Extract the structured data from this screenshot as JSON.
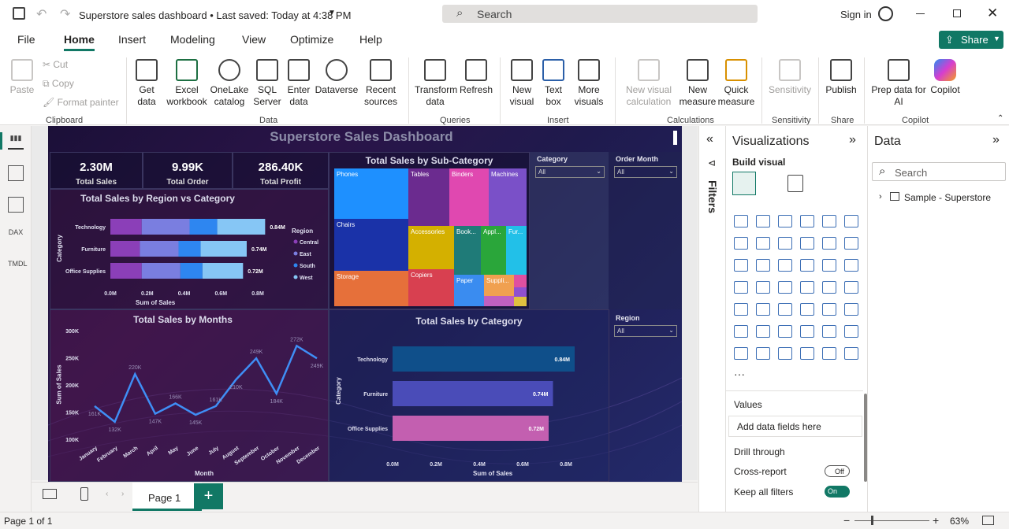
{
  "titlebar": {
    "title": "Superstore sales dashboard • Last saved: Today at 4:38 PM",
    "search": "Search",
    "signin": "Sign in"
  },
  "tabs": [
    "File",
    "Home",
    "Insert",
    "Modeling",
    "View",
    "Optimize",
    "Help"
  ],
  "share": "Share",
  "ribbon": {
    "clipboard": {
      "paste": "Paste",
      "cut": "Cut",
      "copy": "Copy",
      "format_painter": "Format painter",
      "group": "Clipboard"
    },
    "data": {
      "get_data": "Get data",
      "excel": "Excel workbook",
      "onelake": "OneLake catalog",
      "sql": "SQL Server",
      "enter": "Enter data",
      "dataverse": "Dataverse",
      "recent": "Recent sources",
      "group": "Data"
    },
    "queries": {
      "transform": "Transform data",
      "refresh": "Refresh",
      "group": "Queries"
    },
    "insert": {
      "new_visual": "New visual",
      "text_box": "Text box",
      "more_visuals": "More visuals",
      "group": "Insert"
    },
    "calculations": {
      "new_visual_calc": "New visual calculation",
      "new_measure": "New measure",
      "quick_measure": "Quick measure",
      "group": "Calculations"
    },
    "sensitivity": {
      "label": "Sensitivity",
      "group": "Sensitivity"
    },
    "share": {
      "publish": "Publish",
      "group": "Share"
    },
    "copilot": {
      "prep": "Prep data for AI",
      "copilot": "Copilot",
      "group": "Copilot"
    }
  },
  "leftbar": {
    "dax": "DAX",
    "tmdl": "TMDL"
  },
  "dashboard": {
    "title": "Superstore Sales Dashboard",
    "cards": [
      {
        "value": "2.30M",
        "label": "Total Sales"
      },
      {
        "value": "9.99K",
        "label": "Total Order"
      },
      {
        "value": "286.40K",
        "label": "Total Profit"
      }
    ],
    "slicers": {
      "category": "Category",
      "order_month": "Order Month",
      "region": "Region",
      "all": "All"
    },
    "treemap": {
      "title": "Total Sales by Sub-Category",
      "items": [
        "Phones",
        "Tables",
        "Binders",
        "Machines",
        "Chairs",
        "Accessories",
        "Book...",
        "Appl...",
        "Fur...",
        "Storage",
        "Copiers",
        "Paper",
        "Suppli..."
      ]
    },
    "region_chart": {
      "title": "Total Sales by Region vs Category",
      "legend_title": "Region",
      "legend": [
        "Central",
        "East",
        "South",
        "West"
      ],
      "xlabel": "Sum of Sales",
      "ylabel": "Category"
    },
    "months_chart": {
      "title": "Total Sales by Months",
      "xlabel": "Month",
      "ylabel": "Sum of Sales"
    },
    "category_chart": {
      "title": "Total Sales by Category",
      "xlabel": "Sum of Sales",
      "ylabel": "Category"
    }
  },
  "chart_data": [
    {
      "type": "bar",
      "title": "Total Sales by Region vs Category",
      "categories": [
        "Technology",
        "Furniture",
        "Office Supplies"
      ],
      "series": [
        {
          "name": "Central",
          "values": [
            0.17,
            0.16,
            0.17
          ]
        },
        {
          "name": "East",
          "values": [
            0.26,
            0.21,
            0.21
          ]
        },
        {
          "name": "South",
          "values": [
            0.15,
            0.12,
            0.12
          ]
        },
        {
          "name": "West",
          "values": [
            0.26,
            0.25,
            0.22
          ]
        }
      ],
      "totals": [
        "0.84M",
        "0.74M",
        "0.72M"
      ],
      "xticks": [
        "0.0M",
        "0.2M",
        "0.4M",
        "0.6M",
        "0.8M"
      ],
      "xlim": [
        0,
        0.8
      ],
      "xlabel": "Sum of Sales",
      "ylabel": "Category"
    },
    {
      "type": "line",
      "title": "Total Sales by Months",
      "x": [
        "January",
        "February",
        "March",
        "April",
        "May",
        "June",
        "July",
        "August",
        "September",
        "October",
        "November",
        "December"
      ],
      "values": [
        161,
        132,
        220,
        147,
        166,
        145,
        161,
        210,
        249,
        184,
        272,
        249
      ],
      "labels": [
        "161K",
        "132K",
        "220K",
        "147K",
        "166K",
        "145K",
        "161K",
        "210K",
        "249K",
        "184K",
        "272K",
        "249K"
      ],
      "yticks": [
        "300K",
        "250K",
        "200K",
        "150K",
        "100K"
      ],
      "ylim": [
        100,
        300
      ],
      "xlabel": "Month",
      "ylabel": "Sum of Sales"
    },
    {
      "type": "bar",
      "title": "Total Sales by Category",
      "categories": [
        "Technology",
        "Furniture",
        "Office Supplies"
      ],
      "values": [
        0.84,
        0.74,
        0.72
      ],
      "labels": [
        "0.84M",
        "0.74M",
        "0.72M"
      ],
      "colors": [
        "#0f4f8a",
        "#4a4cb8",
        "#c35fb0"
      ],
      "xticks": [
        "0.0M",
        "0.2M",
        "0.4M",
        "0.6M",
        "0.8M"
      ],
      "xlim": [
        0,
        0.8
      ],
      "xlabel": "Sum of Sales",
      "ylabel": "Category"
    }
  ],
  "filters": "Filters",
  "viz": {
    "title": "Visualizations",
    "build": "Build visual",
    "values": "Values",
    "add_fields": "Add data fields here",
    "drill": "Drill through",
    "cross": "Cross-report",
    "off": "Off",
    "keep": "Keep all filters",
    "on": "On"
  },
  "datapane": {
    "title": "Data",
    "search": "Search",
    "table": "Sample - Superstore"
  },
  "pages": {
    "page1": "Page 1"
  },
  "status": {
    "page": "Page 1 of 1",
    "zoom": "63%"
  }
}
